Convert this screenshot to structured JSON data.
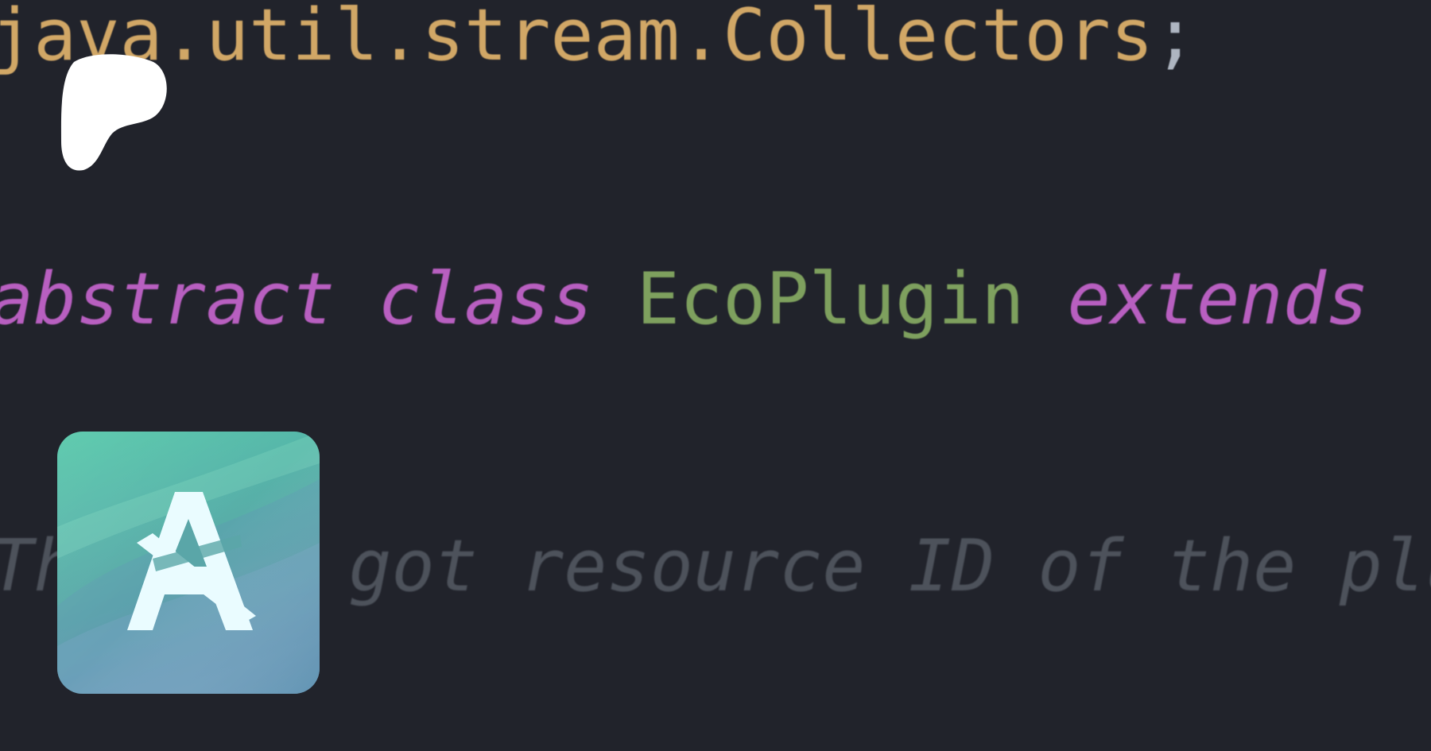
{
  "code": {
    "import_line": "java.util.stream.Collectors",
    "import_semicolon": ";",
    "kw_abstract": "abstract",
    "kw_class": "class",
    "class_name": "EcoPlugin",
    "kw_extends": "extends",
    "comment_before": "Th",
    "comment_after": "got resource ID of the plu"
  },
  "colors": {
    "background": "#21232b",
    "string_import": "#d1a766",
    "keyword": "#b85fc0",
    "type": "#7ea05e",
    "comment": "#4d525b"
  },
  "icons": {
    "logo": "patreon-logo-icon",
    "app": "app-logo-icon"
  }
}
